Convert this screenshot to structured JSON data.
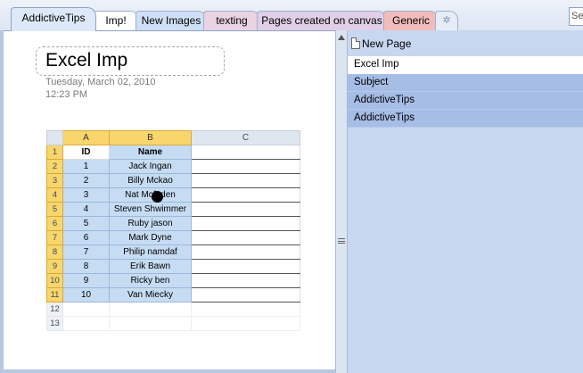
{
  "tabs": [
    {
      "label": "AddictiveTips",
      "active": true,
      "color": "#dde9f8"
    },
    {
      "label": "Imp!",
      "active": false,
      "color": "#ffffff"
    },
    {
      "label": "New Images",
      "active": false,
      "color": "#cfe0f6"
    },
    {
      "label": "texting",
      "active": false,
      "color": "#ead3e2"
    },
    {
      "label": "Pages created on canvas",
      "active": false,
      "color": "#e0cfe6"
    },
    {
      "label": "Generic",
      "active": false,
      "color": "#f3bcbc"
    }
  ],
  "new_tab_icon": "sparkle-icon",
  "search": {
    "value": "Se"
  },
  "page": {
    "title": "Excel Imp",
    "date": "Tuesday, March 02, 2010",
    "time": "12:23 PM"
  },
  "sheet": {
    "columns": [
      "A",
      "B",
      "C"
    ],
    "row_numbers": [
      "1",
      "2",
      "3",
      "4",
      "5",
      "6",
      "7",
      "8",
      "9",
      "10",
      "11",
      "12",
      "13"
    ],
    "header": [
      "ID",
      "Name"
    ],
    "rows": [
      [
        "1",
        "Jack Ingan"
      ],
      [
        "2",
        "Billy Mckao"
      ],
      [
        "3",
        "Nat Mcfaden"
      ],
      [
        "4",
        "Steven Shwimmer"
      ],
      [
        "5",
        "Ruby jason"
      ],
      [
        "6",
        "Mark Dyne"
      ],
      [
        "7",
        "Philip namdaf"
      ],
      [
        "8",
        "Erik Bawn"
      ],
      [
        "9",
        "Ricky ben"
      ],
      [
        "10",
        "Van Miecky"
      ]
    ]
  },
  "pane": {
    "new_page_label": "New Page",
    "pages": [
      "Excel Imp",
      "Subject",
      "AddictiveTips",
      "AddictiveTips"
    ]
  }
}
